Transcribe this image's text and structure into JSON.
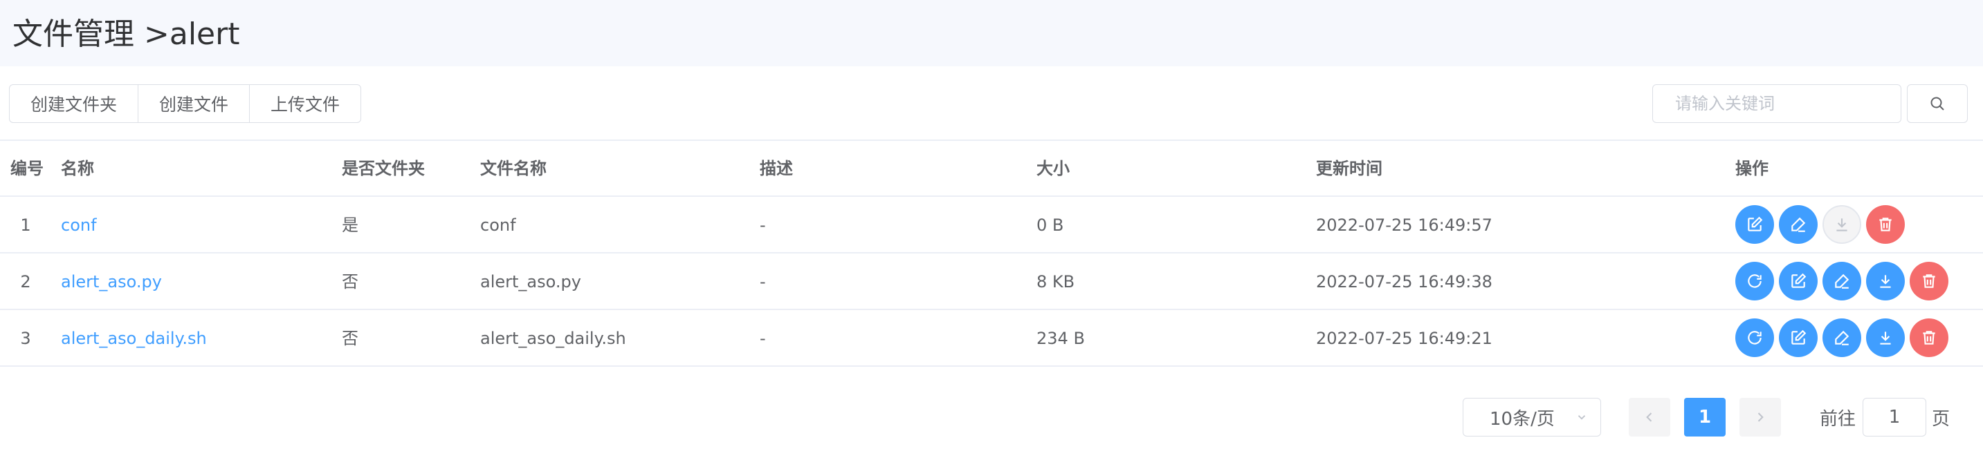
{
  "header": {
    "title": "文件管理 >alert"
  },
  "toolbar": {
    "create_folder": "创建文件夹",
    "create_file": "创建文件",
    "upload_file": "上传文件"
  },
  "search": {
    "placeholder": "请输入关键词",
    "icon": "search-icon"
  },
  "table": {
    "columns": {
      "no": "编号",
      "name": "名称",
      "is_folder": "是否文件夹",
      "file_name": "文件名称",
      "desc": "描述",
      "size": "大小",
      "updated": "更新时间",
      "ops": "操作"
    },
    "rows": [
      {
        "no": "1",
        "name": "conf",
        "is_folder": "是",
        "file_name": "conf",
        "desc": "-",
        "size": "0 B",
        "updated": "2022-07-25 16:49:57",
        "ops": [
          "edit-icon",
          "rename-icon",
          "download-icon",
          "delete-icon"
        ]
      },
      {
        "no": "2",
        "name": "alert_aso.py",
        "is_folder": "否",
        "file_name": "alert_aso.py",
        "desc": "-",
        "size": "8 KB",
        "updated": "2022-07-25 16:49:38",
        "ops": [
          "refresh-icon",
          "edit-icon",
          "rename-icon",
          "download-icon",
          "delete-icon"
        ]
      },
      {
        "no": "3",
        "name": "alert_aso_daily.sh",
        "is_folder": "否",
        "file_name": "alert_aso_daily.sh",
        "desc": "-",
        "size": "234 B",
        "updated": "2022-07-25 16:49:21",
        "ops": [
          "refresh-icon",
          "edit-icon",
          "rename-icon",
          "download-icon",
          "delete-icon"
        ]
      }
    ]
  },
  "pagination": {
    "page_size": "10条/页",
    "current_page": "1",
    "goto_label": "前往",
    "goto_value": "1",
    "page_unit": "页"
  },
  "colors": {
    "primary": "#409eff",
    "danger": "#f56c6c",
    "header_bg": "#f6f8fd"
  }
}
